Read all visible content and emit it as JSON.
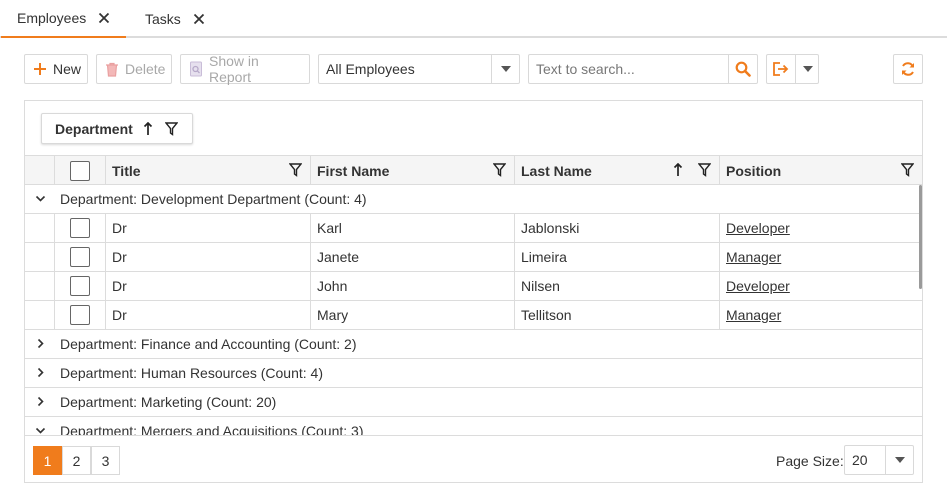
{
  "tabs": [
    {
      "label": "Employees",
      "active": true
    },
    {
      "label": "Tasks",
      "active": false
    }
  ],
  "toolbar": {
    "new_label": "New",
    "delete_label": "Delete",
    "report_label": "Show in Report",
    "filter_value": "All Employees",
    "search_placeholder": "Text to search..."
  },
  "grid": {
    "group_chip": "Department",
    "columns": [
      "Title",
      "First Name",
      "Last Name",
      "Position"
    ],
    "groups": [
      {
        "label": "Department: Development Department (Count: 4)",
        "expanded": true,
        "rows": [
          {
            "title": "Dr",
            "first": "Karl",
            "last": "Jablonski",
            "position": "Developer"
          },
          {
            "title": "Dr",
            "first": "Janete",
            "last": "Limeira",
            "position": "Manager"
          },
          {
            "title": "Dr",
            "first": "John",
            "last": "Nilsen",
            "position": "Developer"
          },
          {
            "title": "Dr",
            "first": "Mary",
            "last": "Tellitson",
            "position": "Manager"
          }
        ]
      },
      {
        "label": "Department: Finance and Accounting (Count: 2)",
        "expanded": false
      },
      {
        "label": "Department: Human Resources (Count: 4)",
        "expanded": false
      },
      {
        "label": "Department: Marketing (Count: 20)",
        "expanded": false
      },
      {
        "label": "Department: Mergers and Acquisitions (Count: 3)",
        "expanded": true
      }
    ]
  },
  "pager": {
    "pages": [
      "1",
      "2",
      "3"
    ],
    "active_page": "1",
    "page_size_label": "Page Size:",
    "page_size_value": "20"
  },
  "colors": {
    "accent": "#f07c1c",
    "border": "#dcdcdc",
    "header_bg": "#f5f5f5"
  },
  "icons": [
    "close-icon",
    "plus-icon",
    "trash-icon",
    "report-icon",
    "chevron-down-icon",
    "search-icon",
    "export-icon",
    "refresh-icon",
    "sort-up-icon",
    "filter-icon",
    "chevron-right-icon"
  ]
}
